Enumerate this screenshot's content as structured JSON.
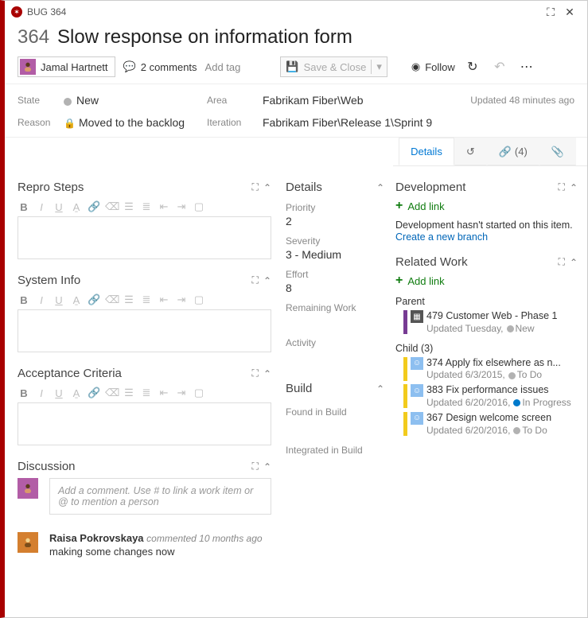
{
  "window": {
    "header": "BUG 364"
  },
  "item": {
    "id": "364",
    "title": "Slow response on information form"
  },
  "toolbar": {
    "assignee": "Jamal Hartnett",
    "comments_count": "2 comments",
    "add_tag": "Add tag",
    "save_close": "Save & Close",
    "follow": "Follow"
  },
  "meta": {
    "state_label": "State",
    "state_value": "New",
    "reason_label": "Reason",
    "reason_value": "Moved to the backlog",
    "area_label": "Area",
    "area_value": "Fabrikam Fiber\\Web",
    "iteration_label": "Iteration",
    "iteration_value": "Fabrikam Fiber\\Release 1\\Sprint 9",
    "updated": "Updated 48 minutes ago"
  },
  "tabs": {
    "details": "Details",
    "links_count": "(4)"
  },
  "left": {
    "repro": "Repro Steps",
    "sysinfo": "System Info",
    "acceptance": "Acceptance Criteria",
    "discussion": "Discussion",
    "comment_placeholder": "Add a comment. Use # to link a work item or @ to mention a person",
    "comment_author": "Raisa Pokrovskaya",
    "comment_meta": "commented 10 months ago",
    "comment_body": "making some changes now"
  },
  "mid": {
    "details_hd": "Details",
    "priority_lbl": "Priority",
    "priority_val": "2",
    "severity_lbl": "Severity",
    "severity_val": "3 - Medium",
    "effort_lbl": "Effort",
    "effort_val": "8",
    "remaining_lbl": "Remaining Work",
    "activity_lbl": "Activity",
    "build_hd": "Build",
    "found_lbl": "Found in Build",
    "integrated_lbl": "Integrated in Build"
  },
  "right": {
    "dev_hd": "Development",
    "add_link": "Add link",
    "dev_note": "Development hasn't started on this item.",
    "create_branch": "Create a new branch",
    "rel_hd": "Related Work",
    "parent_lbl": "Parent",
    "child_lbl": "Child (3)",
    "parent": {
      "id": "479",
      "title": "Customer Web - Phase 1",
      "sub": "Updated Tuesday,",
      "state": "New"
    },
    "children": [
      {
        "id": "374",
        "title": "Apply fix elsewhere as n...",
        "sub": "Updated 6/3/2015,",
        "state": "To Do",
        "state_cls": "st-gray"
      },
      {
        "id": "383",
        "title": "Fix performance issues",
        "sub": "Updated 6/20/2016,",
        "state": "In Progress",
        "state_cls": "st-blue"
      },
      {
        "id": "367",
        "title": "Design welcome screen",
        "sub": "Updated 6/20/2016,",
        "state": "To Do",
        "state_cls": "st-gray"
      }
    ]
  }
}
